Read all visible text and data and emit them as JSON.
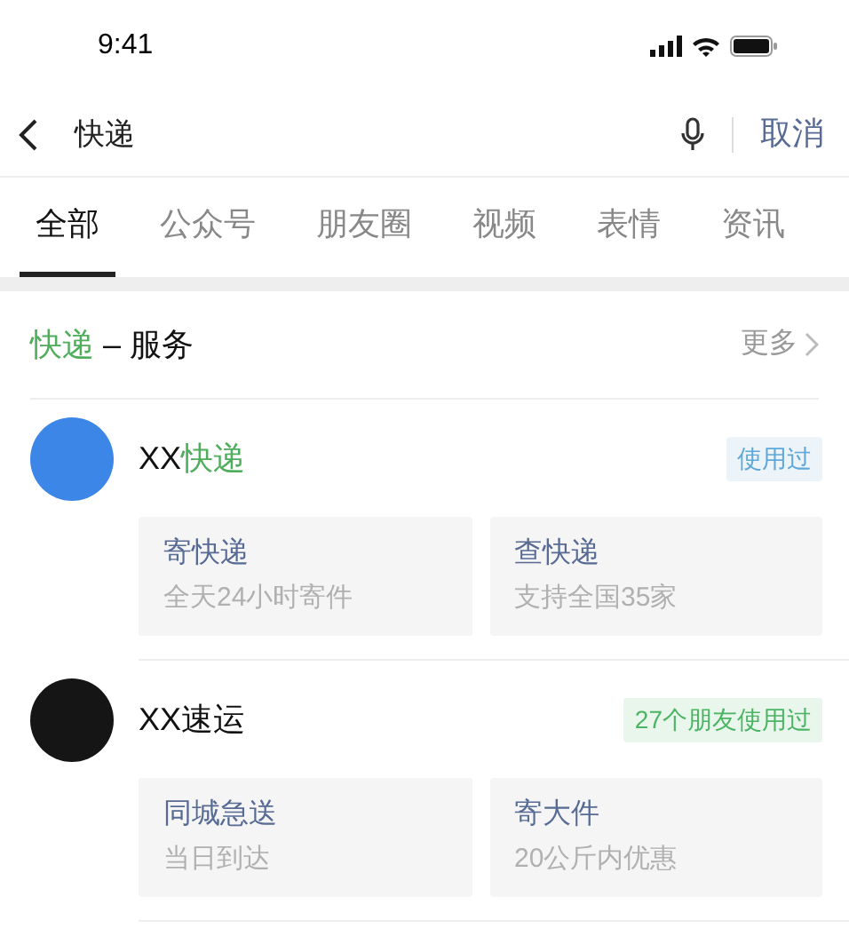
{
  "status_bar": {
    "time": "9:41"
  },
  "search": {
    "value": "快递",
    "cancel": "取消"
  },
  "tabs": [
    {
      "label": "全部",
      "selected": true
    },
    {
      "label": "公众号",
      "selected": false
    },
    {
      "label": "朋友圈",
      "selected": false
    },
    {
      "label": "视频",
      "selected": false
    },
    {
      "label": "表情",
      "selected": false
    },
    {
      "label": "资讯",
      "selected": false
    }
  ],
  "section": {
    "title": [
      {
        "text": "快递",
        "highlight": true
      },
      {
        "text": " – 服务",
        "highlight": false
      }
    ],
    "more": "更多"
  },
  "services": [
    {
      "color": "#3b86e6",
      "name": [
        {
          "text": "XX",
          "highlight": false
        },
        {
          "text": "快递",
          "highlight": true
        }
      ],
      "badge": {
        "text": "使用过",
        "color": "#5fa8d8"
      },
      "actions": [
        {
          "title": "寄快递",
          "subtitle": "全天24小时寄件"
        },
        {
          "title": "查快递",
          "subtitle": "支持全国35家"
        }
      ]
    },
    {
      "color": "#151515",
      "name": [
        {
          "text": "XX速运",
          "highlight": false
        }
      ],
      "badge": {
        "text": "27个朋友使用过",
        "color": "#4cb464"
      },
      "actions": [
        {
          "title": "同城急送",
          "subtitle": "当日到达"
        },
        {
          "title": "寄大件",
          "subtitle": "20公斤内优惠"
        }
      ]
    }
  ]
}
